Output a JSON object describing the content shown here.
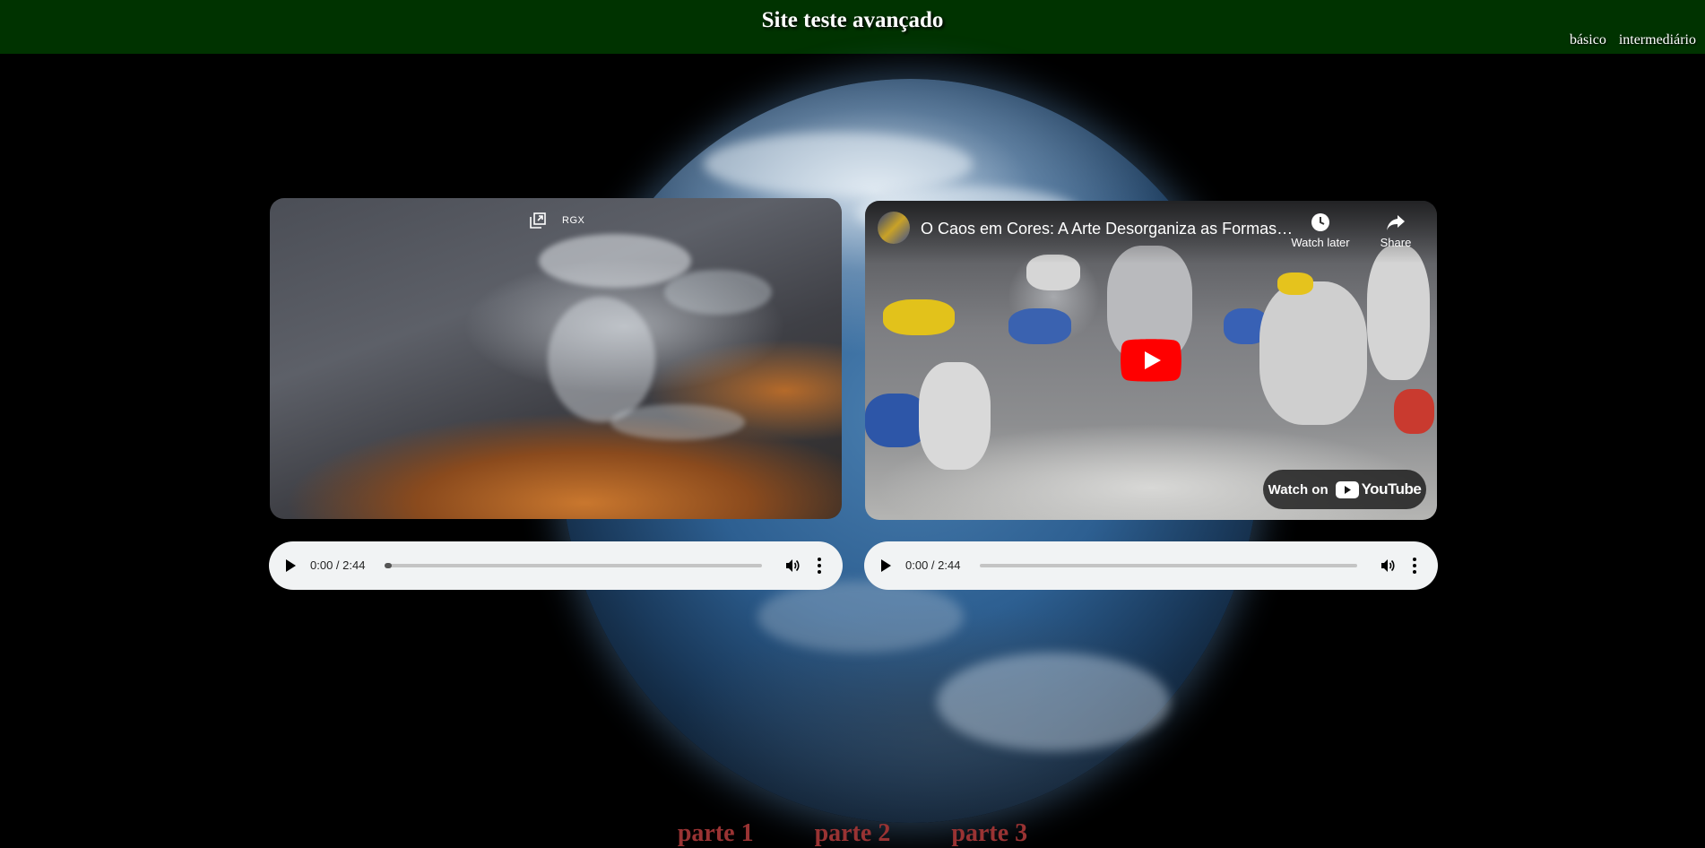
{
  "header": {
    "title": "Site teste avançado",
    "nav": [
      {
        "label": "básico"
      },
      {
        "label": "intermediário"
      }
    ]
  },
  "video_left": {
    "overlay_label": "RGX",
    "icons": [
      "open-in-new-window-icon"
    ]
  },
  "video_right": {
    "title": "O Caos em Cores: A Arte Desorganiza as Formas…",
    "watch_later_label": "Watch later",
    "share_label": "Share",
    "watch_on_label": "Watch on",
    "youtube_label": "YouTube"
  },
  "audio_players": [
    {
      "time": "0:00 / 2:44",
      "progress": 0.02
    },
    {
      "time": "0:00 / 2:44",
      "progress": 0.0
    }
  ],
  "footer": {
    "links": [
      {
        "label": "parte 1"
      },
      {
        "label": "parte 2"
      },
      {
        "label": "parte 3"
      }
    ]
  },
  "colors": {
    "header_bg": "#003300",
    "link_parts": "#993333",
    "youtube_red": "#ff0000"
  }
}
